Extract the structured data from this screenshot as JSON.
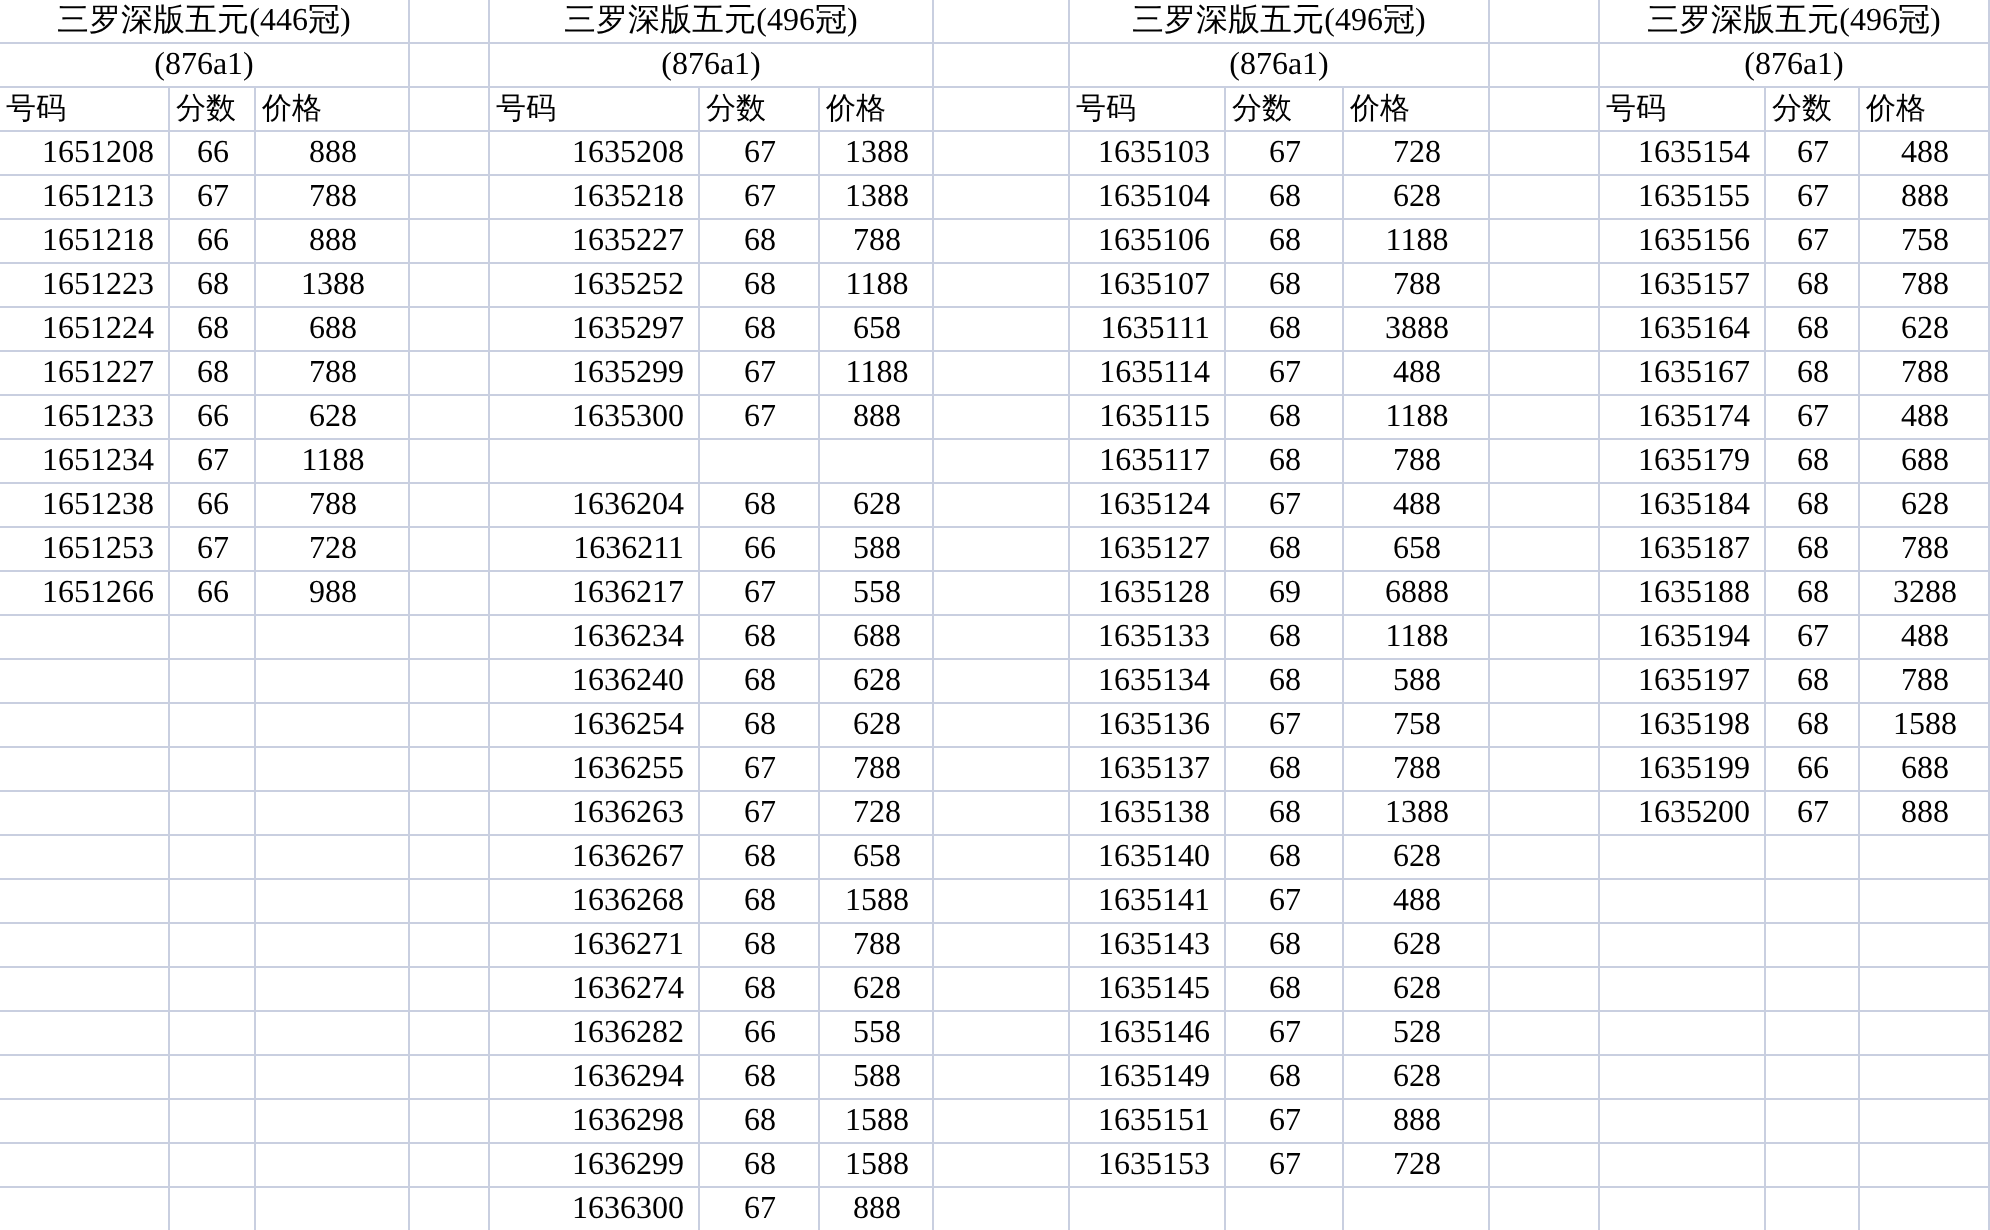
{
  "groups": [
    {
      "title": "三罗深版五元(446冠)",
      "subtitle": "(876a1)",
      "columns": [
        "号码",
        "分数",
        "价格"
      ],
      "rows": [
        {
          "kind": "entry",
          "cells": [
            "1651208",
            "66",
            "888"
          ]
        },
        {
          "kind": "entry",
          "cells": [
            "1651213",
            "67",
            "788"
          ]
        },
        {
          "kind": "entry",
          "cells": [
            "1651218",
            "66",
            "888"
          ]
        },
        {
          "kind": "entry",
          "cells": [
            "1651223",
            "68",
            "1388"
          ]
        },
        {
          "kind": "entry",
          "cells": [
            "1651224",
            "68",
            "688"
          ]
        },
        {
          "kind": "entry",
          "cells": [
            "1651227",
            "68",
            "788"
          ]
        },
        {
          "kind": "entry",
          "cells": [
            "1651233",
            "66",
            "628"
          ]
        },
        {
          "kind": "entry",
          "cells": [
            "1651234",
            "67",
            "1188"
          ]
        },
        {
          "kind": "entry",
          "cells": [
            "1651238",
            "66",
            "788"
          ]
        },
        {
          "kind": "entry",
          "cells": [
            "1651253",
            "67",
            "728"
          ]
        },
        {
          "kind": "entry",
          "cells": [
            "1651266",
            "66",
            "988"
          ]
        }
      ]
    },
    {
      "title": "三罗深版五元(496冠)",
      "subtitle": "(876a1)",
      "columns": [
        "号码",
        "分数",
        "价格"
      ],
      "rows": [
        {
          "kind": "entry",
          "cells": [
            "1635208",
            "67",
            "1388"
          ]
        },
        {
          "kind": "entry",
          "cells": [
            "1635218",
            "67",
            "1388"
          ]
        },
        {
          "kind": "entry",
          "cells": [
            "1635227",
            "68",
            "788"
          ]
        },
        {
          "kind": "entry",
          "cells": [
            "1635252",
            "68",
            "1188"
          ]
        },
        {
          "kind": "entry",
          "cells": [
            "1635297",
            "68",
            "658"
          ]
        },
        {
          "kind": "entry",
          "cells": [
            "1635299",
            "67",
            "1188"
          ]
        },
        {
          "kind": "entry",
          "cells": [
            "1635300",
            "67",
            "888"
          ]
        },
        {
          "kind": "blank"
        },
        {
          "kind": "entry",
          "cells": [
            "1636204",
            "68",
            "628"
          ]
        },
        {
          "kind": "entry",
          "cells": [
            "1636211",
            "66",
            "588"
          ]
        },
        {
          "kind": "entry",
          "cells": [
            "1636217",
            "67",
            "558"
          ]
        },
        {
          "kind": "entry",
          "cells": [
            "1636234",
            "68",
            "688"
          ]
        },
        {
          "kind": "entry",
          "cells": [
            "1636240",
            "68",
            "628"
          ]
        },
        {
          "kind": "entry",
          "cells": [
            "1636254",
            "68",
            "628"
          ]
        },
        {
          "kind": "entry",
          "cells": [
            "1636255",
            "67",
            "788"
          ]
        },
        {
          "kind": "entry",
          "cells": [
            "1636263",
            "67",
            "728"
          ]
        },
        {
          "kind": "entry",
          "cells": [
            "1636267",
            "68",
            "658"
          ]
        },
        {
          "kind": "entry",
          "cells": [
            "1636268",
            "68",
            "1588"
          ]
        },
        {
          "kind": "entry",
          "cells": [
            "1636271",
            "68",
            "788"
          ]
        },
        {
          "kind": "entry",
          "cells": [
            "1636274",
            "68",
            "628"
          ]
        },
        {
          "kind": "entry",
          "cells": [
            "1636282",
            "66",
            "558"
          ]
        },
        {
          "kind": "entry",
          "cells": [
            "1636294",
            "68",
            "588"
          ]
        },
        {
          "kind": "entry",
          "cells": [
            "1636298",
            "68",
            "1588"
          ]
        },
        {
          "kind": "entry",
          "cells": [
            "1636299",
            "68",
            "1588"
          ]
        },
        {
          "kind": "entry",
          "cells": [
            "1636300",
            "67",
            "888"
          ]
        }
      ]
    },
    {
      "title": "三罗深版五元(496冠)",
      "subtitle": "(876a1)",
      "columns": [
        "号码",
        "分数",
        "价格"
      ],
      "rows": [
        {
          "kind": "entry",
          "cells": [
            "1635103",
            "67",
            "728"
          ]
        },
        {
          "kind": "entry",
          "cells": [
            "1635104",
            "68",
            "628"
          ]
        },
        {
          "kind": "entry",
          "cells": [
            "1635106",
            "68",
            "1188"
          ]
        },
        {
          "kind": "entry",
          "cells": [
            "1635107",
            "68",
            "788"
          ]
        },
        {
          "kind": "entry",
          "cells": [
            "1635111",
            "68",
            "3888"
          ]
        },
        {
          "kind": "entry",
          "cells": [
            "1635114",
            "67",
            "488"
          ]
        },
        {
          "kind": "entry",
          "cells": [
            "1635115",
            "68",
            "1188"
          ]
        },
        {
          "kind": "entry",
          "cells": [
            "1635117",
            "68",
            "788"
          ]
        },
        {
          "kind": "entry",
          "cells": [
            "1635124",
            "67",
            "488"
          ]
        },
        {
          "kind": "entry",
          "cells": [
            "1635127",
            "68",
            "658"
          ]
        },
        {
          "kind": "entry",
          "cells": [
            "1635128",
            "69",
            "6888"
          ]
        },
        {
          "kind": "entry",
          "cells": [
            "1635133",
            "68",
            "1188"
          ]
        },
        {
          "kind": "entry",
          "cells": [
            "1635134",
            "68",
            "588"
          ]
        },
        {
          "kind": "entry",
          "cells": [
            "1635136",
            "67",
            "758"
          ]
        },
        {
          "kind": "entry",
          "cells": [
            "1635137",
            "68",
            "788"
          ]
        },
        {
          "kind": "entry",
          "cells": [
            "1635138",
            "68",
            "1388"
          ]
        },
        {
          "kind": "entry",
          "cells": [
            "1635140",
            "68",
            "628"
          ]
        },
        {
          "kind": "entry",
          "cells": [
            "1635141",
            "67",
            "488"
          ]
        },
        {
          "kind": "entry",
          "cells": [
            "1635143",
            "68",
            "628"
          ]
        },
        {
          "kind": "entry",
          "cells": [
            "1635145",
            "68",
            "628"
          ]
        },
        {
          "kind": "entry",
          "cells": [
            "1635146",
            "67",
            "528"
          ]
        },
        {
          "kind": "entry",
          "cells": [
            "1635149",
            "68",
            "628"
          ]
        },
        {
          "kind": "entry",
          "cells": [
            "1635151",
            "67",
            "888"
          ]
        },
        {
          "kind": "entry",
          "cells": [
            "1635153",
            "67",
            "728"
          ]
        }
      ]
    },
    {
      "title": "三罗深版五元(496冠)",
      "subtitle": "(876a1)",
      "columns": [
        "号码",
        "分数",
        "价格"
      ],
      "rows": [
        {
          "kind": "entry",
          "cells": [
            "1635154",
            "67",
            "488"
          ]
        },
        {
          "kind": "entry",
          "cells": [
            "1635155",
            "67",
            "888"
          ]
        },
        {
          "kind": "entry",
          "cells": [
            "1635156",
            "67",
            "758"
          ]
        },
        {
          "kind": "entry",
          "cells": [
            "1635157",
            "68",
            "788"
          ]
        },
        {
          "kind": "entry",
          "cells": [
            "1635164",
            "68",
            "628"
          ]
        },
        {
          "kind": "entry",
          "cells": [
            "1635167",
            "68",
            "788"
          ]
        },
        {
          "kind": "entry",
          "cells": [
            "1635174",
            "67",
            "488"
          ]
        },
        {
          "kind": "entry",
          "cells": [
            "1635179",
            "68",
            "688"
          ]
        },
        {
          "kind": "entry",
          "cells": [
            "1635184",
            "68",
            "628"
          ]
        },
        {
          "kind": "entry",
          "cells": [
            "1635187",
            "68",
            "788"
          ]
        },
        {
          "kind": "entry",
          "cells": [
            "1635188",
            "68",
            "3288"
          ]
        },
        {
          "kind": "entry",
          "cells": [
            "1635194",
            "67",
            "488"
          ]
        },
        {
          "kind": "entry",
          "cells": [
            "1635197",
            "68",
            "788"
          ]
        },
        {
          "kind": "entry",
          "cells": [
            "1635198",
            "68",
            "1588"
          ]
        },
        {
          "kind": "entry",
          "cells": [
            "1635199",
            "66",
            "688"
          ]
        },
        {
          "kind": "entry",
          "cells": [
            "1635200",
            "67",
            "888"
          ]
        }
      ]
    }
  ]
}
